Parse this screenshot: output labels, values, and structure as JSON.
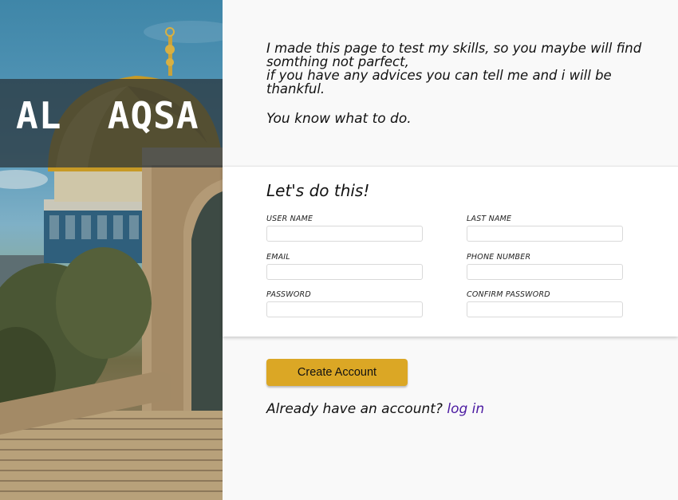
{
  "hero": {
    "title": "AL  AQSA",
    "image_desc_icon": "dome-of-the-rock-image"
  },
  "intro": {
    "line1": "I made this page to test my skills, so you maybe will find",
    "line2": "somthing not parfect,",
    "line3": "if you have any advices you can tell me and i will be thankful.",
    "line4": "You know what to do."
  },
  "form": {
    "heading": "Let's do this!",
    "fields": [
      {
        "label": "USER NAME",
        "value": ""
      },
      {
        "label": "LAST NAME",
        "value": ""
      },
      {
        "label": "EMAIL",
        "value": ""
      },
      {
        "label": "PHONE NUMBER",
        "value": ""
      },
      {
        "label": "PASSWORD",
        "value": ""
      },
      {
        "label": "CONFIRM PASSWORD",
        "value": ""
      }
    ],
    "submit_label": "Create Account"
  },
  "footer": {
    "prompt": "Already have an account?",
    "link_label": "log in"
  },
  "colors": {
    "accent_button": "#dba725",
    "link": "#4b1aa1",
    "page_bg": "#f9f9f9",
    "card_bg": "#ffffff"
  }
}
